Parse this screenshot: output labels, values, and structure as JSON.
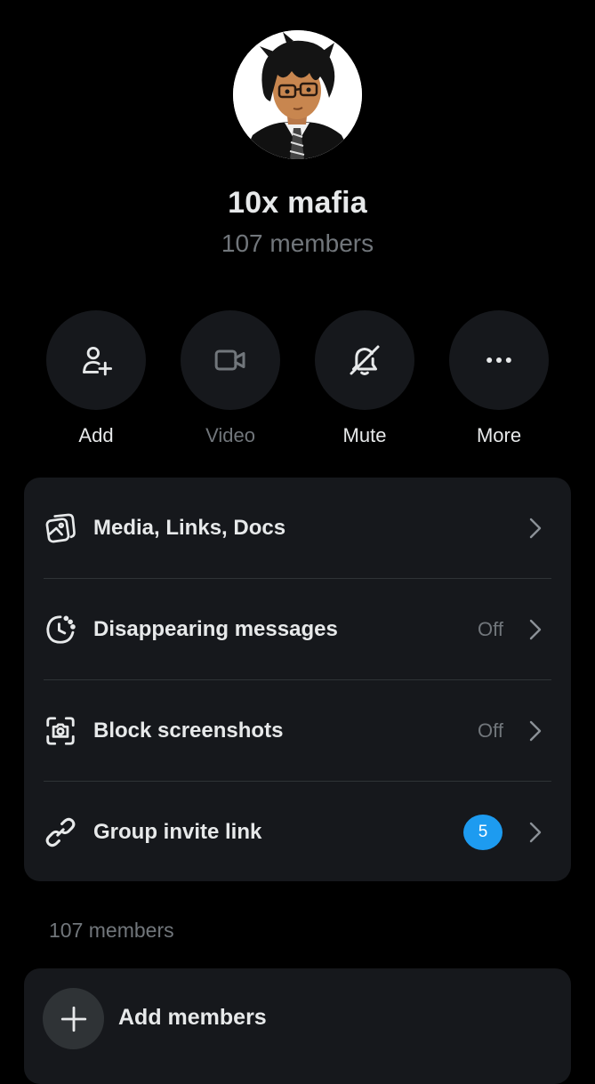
{
  "header": {
    "group_name": "10x mafia",
    "member_count": "107 members",
    "avatar": "anime-character-avatar"
  },
  "actions": [
    {
      "label": "Add",
      "icon": "add-user-icon",
      "enabled": true
    },
    {
      "label": "Video",
      "icon": "video-camera-icon",
      "enabled": false
    },
    {
      "label": "Mute",
      "icon": "bell-off-icon",
      "enabled": true
    },
    {
      "label": "More",
      "icon": "more-dots-icon",
      "enabled": true
    }
  ],
  "settings": {
    "media": {
      "label": "Media, Links, Docs",
      "icon": "media-gallery-icon"
    },
    "disappearing": {
      "label": "Disappearing messages",
      "value": "Off",
      "icon": "timer-clock-icon"
    },
    "screenshots": {
      "label": "Block screenshots",
      "value": "Off",
      "icon": "camera-scan-icon"
    },
    "invite": {
      "label": "Group invite link",
      "badge": "5",
      "icon": "link-icon"
    }
  },
  "members_section": {
    "header": "107 members",
    "add_label": "Add members"
  },
  "colors": {
    "background": "#000000",
    "card": "#16181c",
    "text_primary": "#e7e9ea",
    "text_secondary": "#71767b",
    "accent": "#1d9bf0"
  }
}
